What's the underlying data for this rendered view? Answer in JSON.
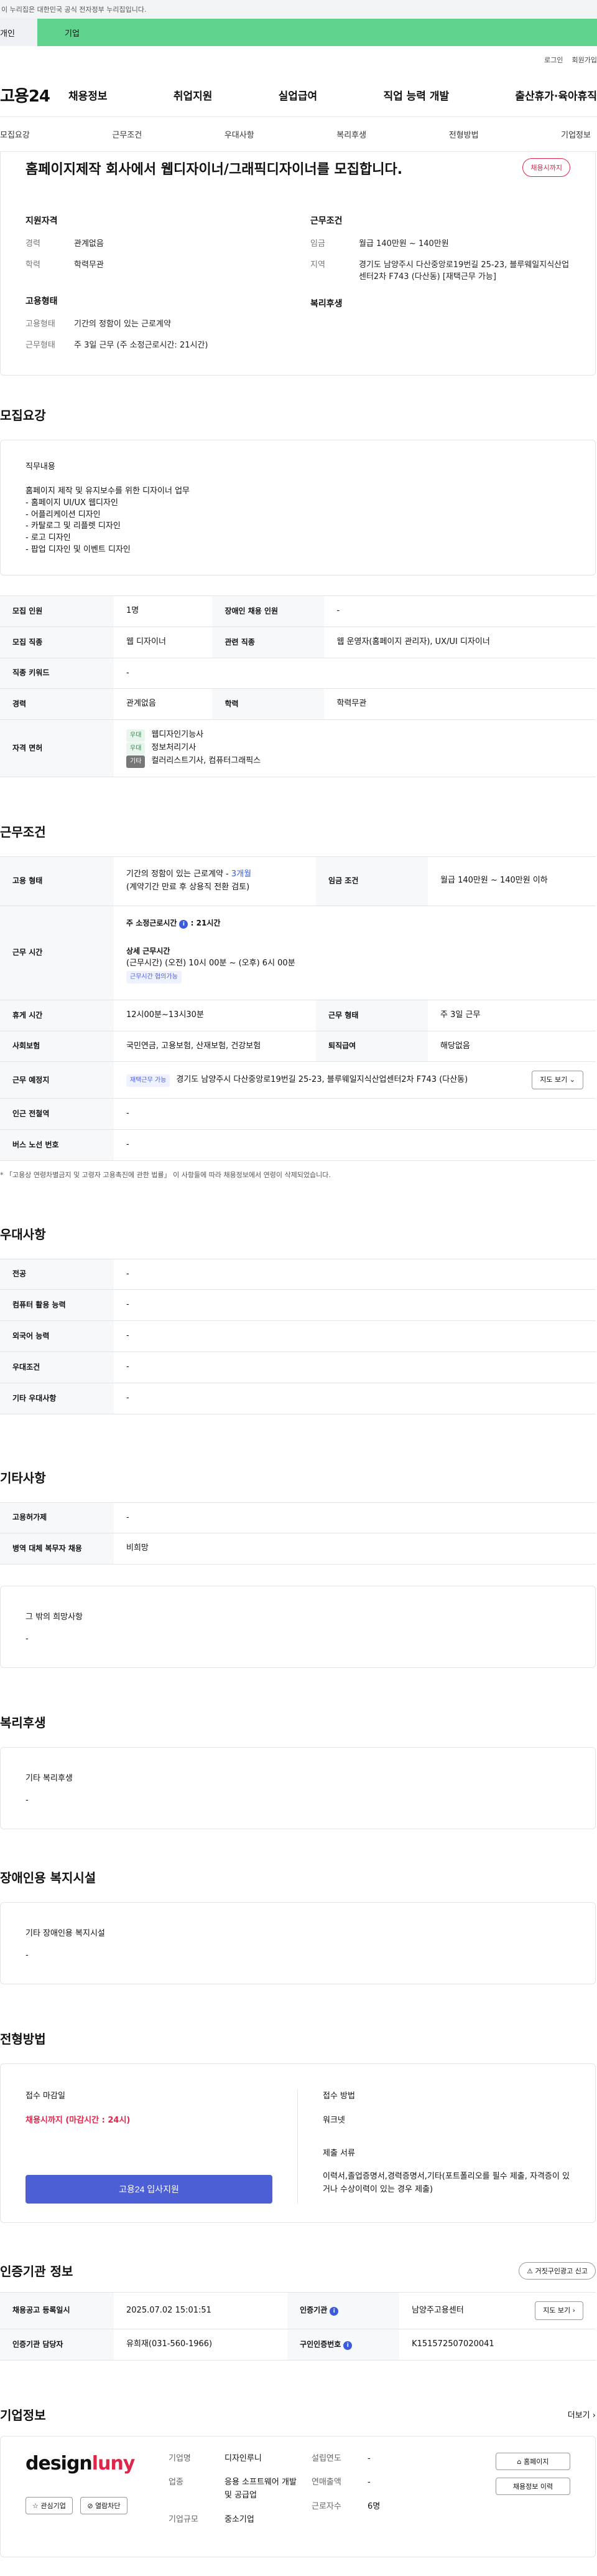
{
  "gov_banner": "이 누리집은 대한민국 공식 전자정부 누리집입니다.",
  "site_tabs": {
    "left": "개인",
    "right": "기업"
  },
  "util": {
    "login": "로그인",
    "signup": "회원가입"
  },
  "logo": "고용24",
  "gnb": [
    "채용정보",
    "취업지원",
    "실업급여",
    "직업 능력 개발",
    "출산휴가·육아휴직"
  ],
  "anchor_nav": [
    "모집요강",
    "근무조건",
    "우대사항",
    "복리후생",
    "전형방법",
    "기업정보"
  ],
  "summary": {
    "title": "홈페이지제작 회사에서 웹디자이너/그래픽디자이너를 모집합니다.",
    "status_badge": "채용시까지",
    "qual_title": "지원자격",
    "career_k": "경력",
    "career_v": "관계없음",
    "edu_k": "학력",
    "edu_v": "학력무관",
    "cond_title": "근무조건",
    "wage_k": "임금",
    "wage_v": "월급 140만원 ~ 140만원",
    "area_k": "지역",
    "area_v": "경기도 남양주시 다산중앙로19번길 25-23, 블루웨일지식산업센터2차 F743 (다산동) [재택근무 가능]",
    "emp_title": "고용형태",
    "emptype_k": "고용형태",
    "emptype_v": "기간의 정함이 있는 근로계약",
    "worktype_k": "근무형태",
    "worktype_v": "주 3일 근무 (주 소정근로시간: 21시간)",
    "welfare_title": "복리후생"
  },
  "recruit": {
    "section_title": "모집요강",
    "duty_title": "직무내용",
    "duty_lines": [
      "홈페이지 제작 및 유지보수를 위한 디자이너 업무",
      "- 홈페이지 UI/UX 웹디자인",
      "- 어플리케이션 디자인",
      "- 카탈로그 및 리플렛 디자인",
      "- 로고 디자인",
      "- 팝업 디자인 및 이벤트 디자인"
    ],
    "headcount_k": "모집 인원",
    "headcount_v": "1명",
    "disabled_k": "장애인 채용 인원",
    "disabled_v": "-",
    "job_k": "모집 직종",
    "job_v": "웹 디자이너",
    "related_k": "관련 직종",
    "related_v": "웹 운영자(홈페이지 관리자), UX/UI 디자이너",
    "keyword_k": "직종 키워드",
    "keyword_v": "-",
    "career_k": "경력",
    "career_v": "관계없음",
    "edu_k": "학력",
    "edu_v": "학력무관",
    "license_k": "자격 면허",
    "licenses": [
      {
        "tag": "우대",
        "name": "웹디자인기능사"
      },
      {
        "tag": "우대",
        "name": "정보처리기사"
      },
      {
        "tag": "기타",
        "name": "컬러리스트기사, 컴퓨터그래픽스"
      }
    ]
  },
  "work": {
    "section_title": "근무조건",
    "emptype_k": "고용 형태",
    "emptype_v1": "기간의 정함이 있는 근로계약 - ",
    "emptype_months": "3개월",
    "emptype_v2": "(계약기간 만료 후 상용직 전환 검토)",
    "wage_k": "임금 조건",
    "wage_v": "월급 140만원 ~ 140만원 이하",
    "hours_k": "근무 시간",
    "hours_week_label": "주 소정근로시간",
    "hours_week_v": "21시간",
    "hours_detail_label": "상세 근무시간",
    "hours_detail_v": "(근무시간) (오전) 10시 00분 ~ (오후) 6시 00분",
    "hours_tag": "근무시간 협의가능",
    "break_k": "휴게 시간",
    "break_v": "12시00분~13시30분",
    "worktype_k": "근무 형태",
    "worktype_v": "주 3일 근무",
    "insurance_k": "사회보험",
    "insurance_v": "국민연금, 고용보험, 산재보험, 건강보험",
    "severance_k": "퇴직급여",
    "severance_v": "해당없음",
    "place_k": "근무 예정지",
    "place_tag": "재택근무 가능",
    "place_v": "경기도 남양주시 다산중앙로19번길 25-23, 블루웨일지식산업센터2차 F743 (다산동)",
    "map_btn": "지도 보기",
    "subway_k": "인근 전철역",
    "subway_v": "-",
    "bus_k": "버스 노선 번호",
    "bus_v": "-",
    "note": "* 「고용상 연령차별금지 및 고령자 고용촉진에 관한 법률」 이 사항들에 따라 채용정보에서 연령이 삭제되었습니다."
  },
  "prefer": {
    "section_title": "우대사항",
    "major_k": "전공",
    "major_v": "-",
    "pc_k": "컴퓨터 활용 능력",
    "pc_v": "-",
    "lang_k": "외국어 능력",
    "lang_v": "-",
    "cond_k": "우대조건",
    "cond_v": "-",
    "etc_k": "기타 우대사항",
    "etc_v": "-"
  },
  "etc": {
    "section_title": "기타사항",
    "permit_k": "고용허가제",
    "permit_v": "-",
    "military_k": "병역 대체 복무자 채용",
    "military_v": "비희망",
    "hope_title": "그 밖의 희망사항",
    "hope_v": "-"
  },
  "welfare": {
    "section_title": "복리후생",
    "etc_title": "기타 복리후생",
    "etc_v": "-"
  },
  "disabled_facility": {
    "section_title": "장애인용 복지시설",
    "title": "기타 장애인용 복지시설",
    "value": "-"
  },
  "process": {
    "section_title": "전형방법",
    "deadline_title": "접수 마감일",
    "deadline_v": "채용시까지 (마감시간 : 24시)",
    "apply_btn": "고용24 입사지원",
    "method_title": "접수 방법",
    "method_v": "워크넷",
    "docs_title": "제출 서류",
    "docs_v": "이력서,졸업증명서,경력증명서,기타(포트폴리오를 필수 제출, 자격증이 있거나 수상이력이 있는 경우 제출)"
  },
  "agency": {
    "section_title": "인증기관 정보",
    "report_btn": "거짓구인광고 신고",
    "reg_k": "채용공고 등록일시",
    "reg_v": "2025.07.02 15:01:51",
    "org_k": "인증기관",
    "org_v": "남양주고용센터",
    "map_btn": "지도 보기",
    "manager_k": "인증기관 담당자",
    "manager_v": "유희재(031-560-1966)",
    "num_k": "구인인증번호",
    "num_v": "K151572507020041"
  },
  "company": {
    "section_title": "기업정보",
    "more": "더보기",
    "brand_a": "design",
    "brand_b": "luny",
    "fav_btn": "관심기업",
    "block_btn": "열람차단",
    "name_k": "기업명",
    "name_v": "디자인루니",
    "industry_k": "업종",
    "industry_v": "응용 소프트웨어 개발 및 공급업",
    "size_k": "기업규모",
    "size_v": "중소기업",
    "year_k": "설립연도",
    "year_v": "-",
    "sales_k": "연매출액",
    "sales_v": "-",
    "emp_k": "근로자수",
    "emp_v": "6명",
    "home_btn": "홈페이지",
    "history_btn": "채용정보 이력"
  }
}
